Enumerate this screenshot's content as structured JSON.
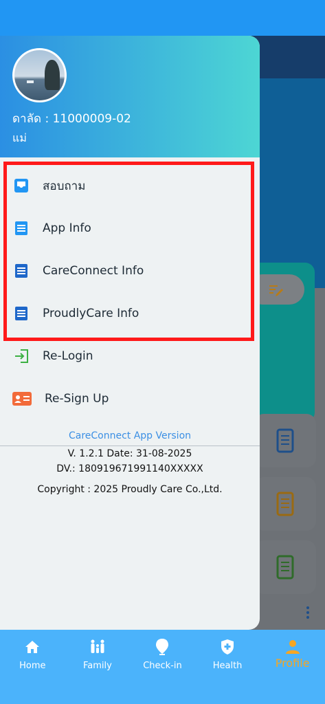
{
  "drawer": {
    "user_id": "ดาลัด : 11000009-02",
    "user_role": "แม่",
    "menu": [
      {
        "label": "สอบถาม",
        "icon": "inbox-icon"
      },
      {
        "label": "App Info",
        "icon": "document-icon"
      },
      {
        "label": "CareConnect Info",
        "icon": "document-icon"
      },
      {
        "label": "ProudlyCare Info",
        "icon": "document-icon"
      },
      {
        "label": "Re-Login",
        "icon": "login-icon"
      },
      {
        "label": "Re-Sign Up",
        "icon": "id-card-icon"
      }
    ],
    "version": {
      "title": "CareConnect App Version",
      "line1": "V. 1.2.1    Date: 31-08-2025",
      "line2": "DV.: 180919671991140XXXXX",
      "copyright": "Copyright : 2025 Proudly Care Co.,Ltd."
    }
  },
  "bottom_nav": [
    {
      "label": "Home",
      "icon": "home-icon"
    },
    {
      "label": "Family",
      "icon": "family-icon"
    },
    {
      "label": "Check-in",
      "icon": "location-icon"
    },
    {
      "label": "Health",
      "icon": "shield-icon"
    },
    {
      "label": "Profile",
      "icon": "person-icon",
      "active": true
    }
  ],
  "colors": {
    "accent": "#2196f3",
    "highlight": "#ff1a1a",
    "active_nav": "#f5a623",
    "teal": "#4dd6d4"
  }
}
